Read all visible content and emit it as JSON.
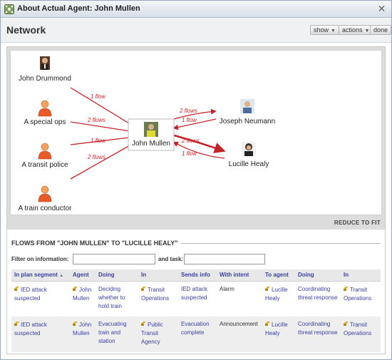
{
  "window": {
    "title": "About Actual Agent: John Mullen",
    "close_icon": "close-icon",
    "app_icon": "network-icon"
  },
  "header": {
    "title": "Network",
    "buttons": {
      "show": "show",
      "actions": "actions",
      "done": "done"
    }
  },
  "network": {
    "center": {
      "label": "John Mullen"
    },
    "sources": [
      {
        "label": "John Drummond",
        "avatar": "photo"
      },
      {
        "label": "A special ops",
        "avatar": "generic-person"
      },
      {
        "label": "A transit police",
        "avatar": "generic-person"
      },
      {
        "label": "A train conductor",
        "avatar": "generic-person"
      }
    ],
    "targets": [
      {
        "label": "Joseph Neumann",
        "avatar": "photo"
      },
      {
        "label": "Lucille Healy",
        "avatar": "photo"
      }
    ],
    "flow_labels": {
      "drummond": "1 flow",
      "special_ops": "2 flows",
      "transit_police": "1 flow",
      "train_conductor": "2 flows",
      "to_neumann": "2 flows",
      "from_neumann": "1 flow",
      "to_healy": "2 flows",
      "from_healy": "1 flow"
    },
    "reduce_label": "REDUCE TO FIT",
    "flow_color": "#c2232b"
  },
  "flows": {
    "title": "FLOWS FROM \"JOHN MULLEN\" TO \"LUCILLE HEALY\"",
    "filter_label": "Filter on information:",
    "task_label": "and task:",
    "columns": [
      "In plan segment",
      "Agent",
      "Doing",
      "In",
      "Sends info",
      "With intent",
      "To agent",
      "Doing",
      "In"
    ],
    "sort_indicator": "▲",
    "rows": [
      [
        "IED attack suspected",
        "John Mullen",
        "Deciding whether to hold train",
        "Transit Operations",
        "IED attack suspected",
        "Alarm",
        "Lucille Healy",
        "Coordinating threat response",
        "Transit Operations"
      ],
      [
        "IED attack suspected",
        "John Mullen",
        "Evacuating train and station",
        "Public Transit Agency",
        "Evacuation complete",
        "Announcement",
        "Lucille Healy",
        "Coordinating threat response",
        "Transit Operations"
      ]
    ]
  }
}
